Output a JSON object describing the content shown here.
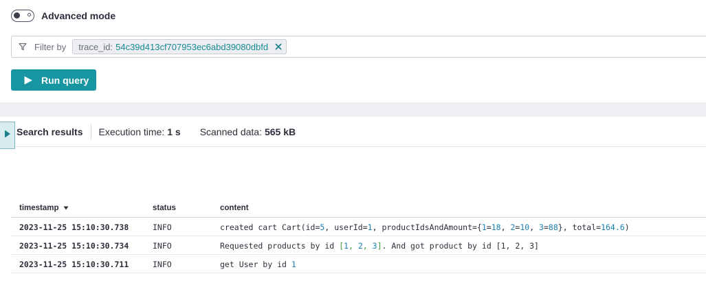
{
  "advanced_mode": {
    "label": "Advanced mode",
    "enabled": false
  },
  "filter": {
    "label": "Filter by",
    "chip_key": "trace_id:",
    "chip_value": "54c39d413cf707953ec6abd39080dbfd"
  },
  "run_query": {
    "label": "Run query"
  },
  "results": {
    "title": "Search results",
    "execution_label": "Execution time:",
    "execution_value": "1 s",
    "scanned_label": "Scanned data:",
    "scanned_value": "565 kB"
  },
  "table": {
    "columns": [
      "timestamp",
      "status",
      "content"
    ],
    "rows": [
      {
        "timestamp": "2023-11-25 15:10:30.738",
        "status": "INFO",
        "content": "created cart Cart(id=5, userId=1, productIdsAndAmount={1=18, 2=10, 3=88}, total=164.6)"
      },
      {
        "timestamp": "2023-11-25 15:10:30.734",
        "status": "INFO",
        "content": "Requested products by id [1, 2, 3]. And got product by id [1, 2, 3]"
      },
      {
        "timestamp": "2023-11-25 15:10:30.711",
        "status": "INFO",
        "content": "get User by id 1"
      }
    ]
  },
  "colors": {
    "accent": "#1795a0",
    "number": "#1a80b0",
    "highlight_green": "#3a9a3a"
  },
  "icons": [
    "filter-icon",
    "close-icon",
    "play-icon",
    "sort-down-icon",
    "expand-icon"
  ]
}
